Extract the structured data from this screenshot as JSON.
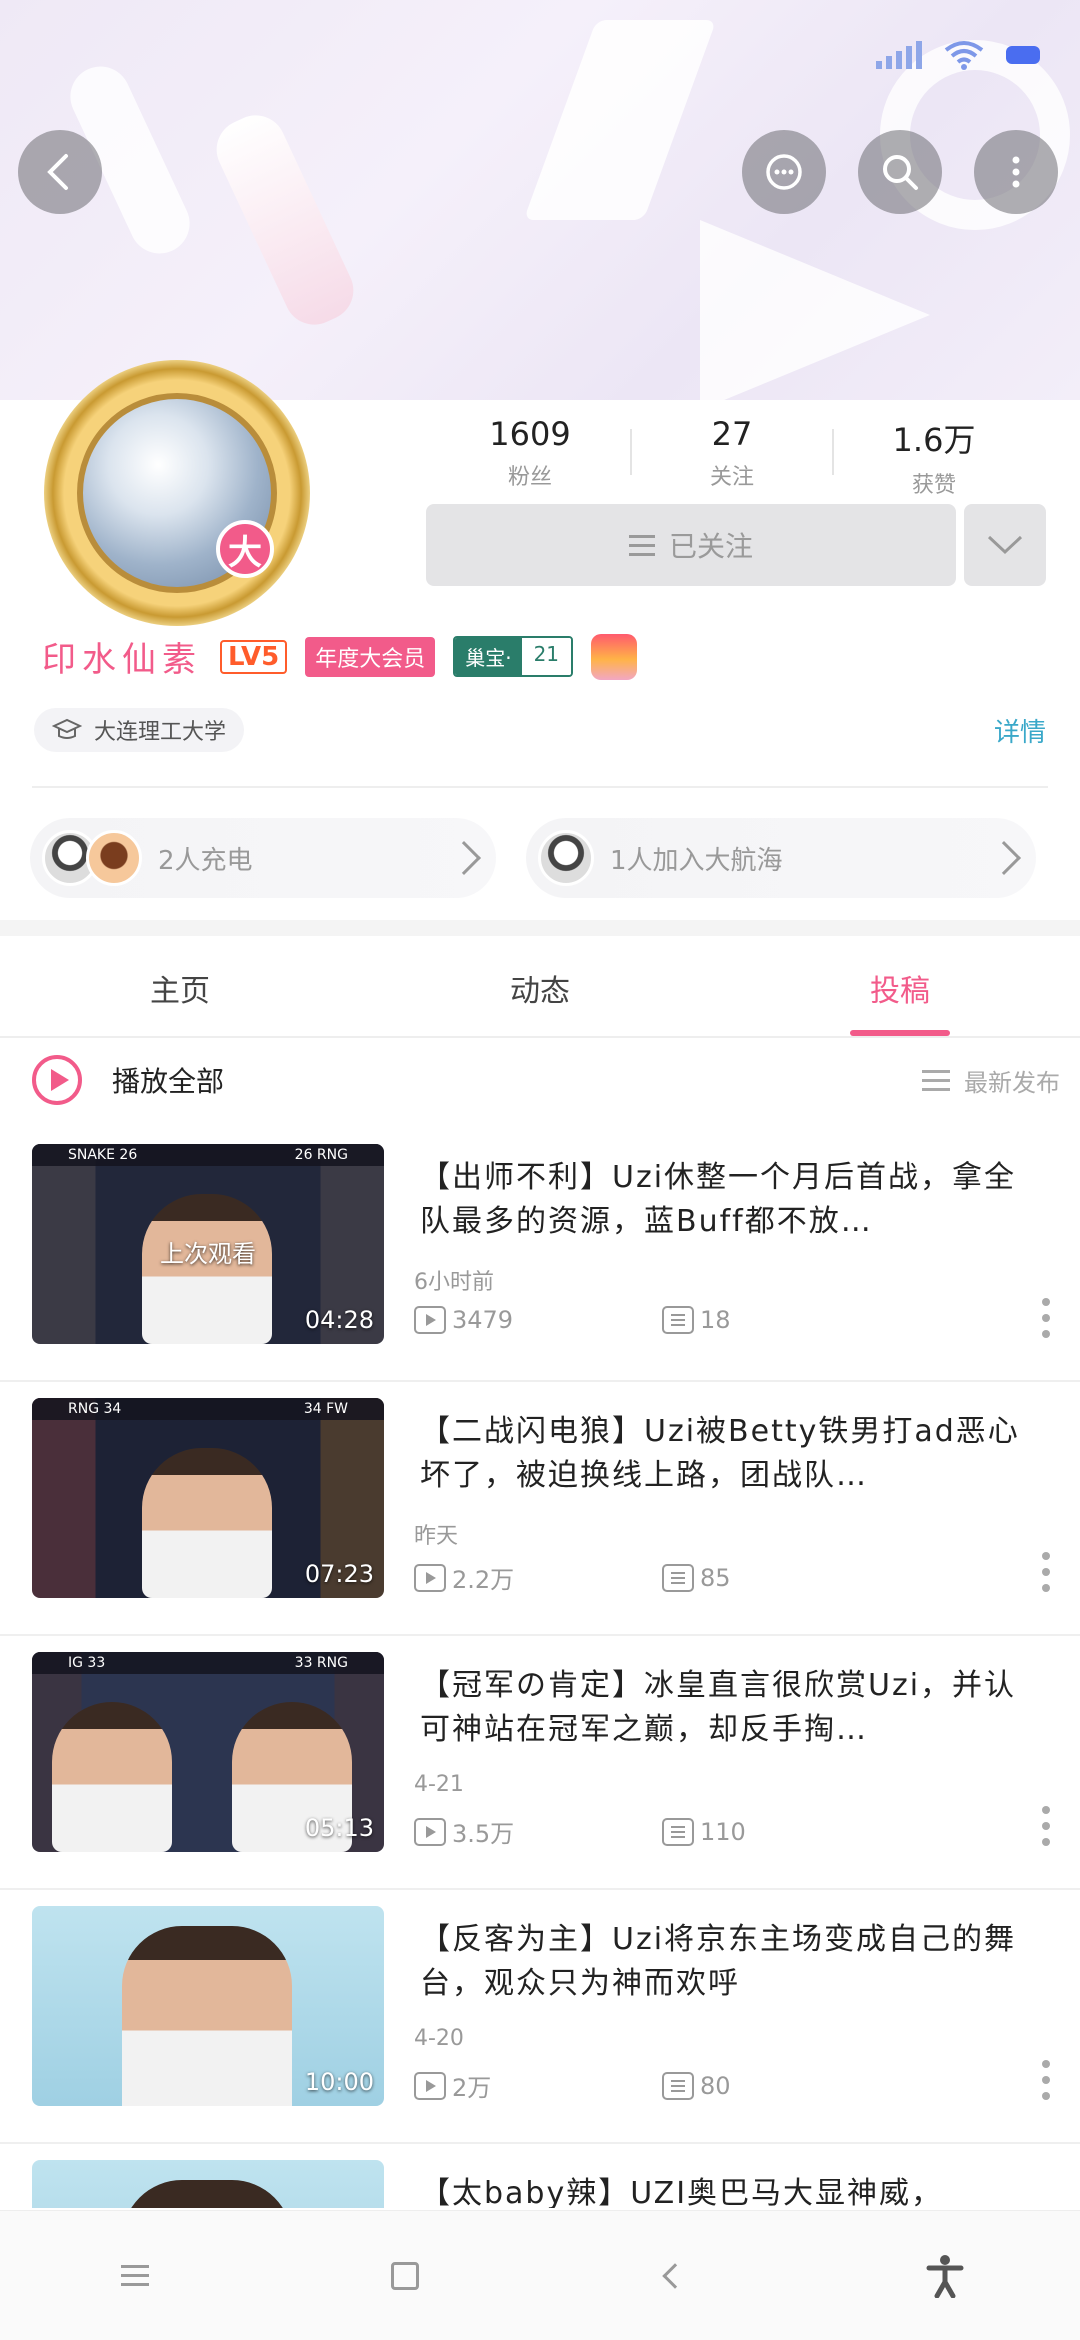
{
  "header": {
    "back_icon": "back-arrow-icon",
    "chat_icon": "chat-icon",
    "search_icon": "search-icon",
    "more_icon": "more-icon"
  },
  "profile": {
    "avatar_badge": "大",
    "username": "印水仙素",
    "level": "LV5",
    "vip_tag": "年度大会员",
    "medal_name": "巢宝·",
    "medal_level": "21",
    "school": "大连理工大学",
    "detail_link": "详情",
    "stats": [
      {
        "num": "1609",
        "label": "粉丝"
      },
      {
        "num": "27",
        "label": "关注"
      },
      {
        "num": "1.6万",
        "label": "获赞"
      }
    ],
    "follow_label": "已关注"
  },
  "charge": {
    "left_label": "2人充电",
    "right_label": "1人加入大航海"
  },
  "tabs": [
    {
      "label": "主页"
    },
    {
      "label": "动态"
    },
    {
      "label": "投稿"
    }
  ],
  "toolbar": {
    "play_all": "播放全部",
    "sort": "最新发布"
  },
  "videos": [
    {
      "title": "【出师不利】Uzi休整一个月后首战，拿全队最多的资源，蓝Buff都不放…",
      "date": "6小时前",
      "views": "3479",
      "danmaku": "18",
      "duration": "04:28",
      "watched": "上次观看",
      "score_left": "SNAKE 26",
      "score_right": "26 RNG"
    },
    {
      "title": "【二战闪电狼】Uzi被Betty铁男打ad恶心坏了，被迫换线上路，团战队…",
      "date": "昨天",
      "views": "2.2万",
      "danmaku": "85",
      "duration": "07:23",
      "watched": "",
      "score_left": "RNG 34",
      "score_right": "34 FW"
    },
    {
      "title": "【冠军の肯定】冰皇直言很欣赏Uzi，并认可神站在冠军之巅，却反手掏…",
      "date": "4-21",
      "views": "3.5万",
      "danmaku": "110",
      "duration": "05:13",
      "watched": "",
      "score_left": "IG 33",
      "score_right": "33 RNG"
    },
    {
      "title": "【反客为主】Uzi将京东主场变成自己的舞台，观众只为神而欢呼",
      "date": "4-20",
      "views": "2万",
      "danmaku": "80",
      "duration": "10:00",
      "watched": "",
      "score_left": "",
      "score_right": ""
    },
    {
      "title": "【太baby辣】UZI奥巴马大显神威，",
      "date": "",
      "views": "",
      "danmaku": "",
      "duration": "",
      "watched": "",
      "score_left": "",
      "score_right": ""
    }
  ],
  "colors": {
    "accent": "#f25b8a",
    "link": "#3aa8c9",
    "medal": "#2a7d6a"
  }
}
